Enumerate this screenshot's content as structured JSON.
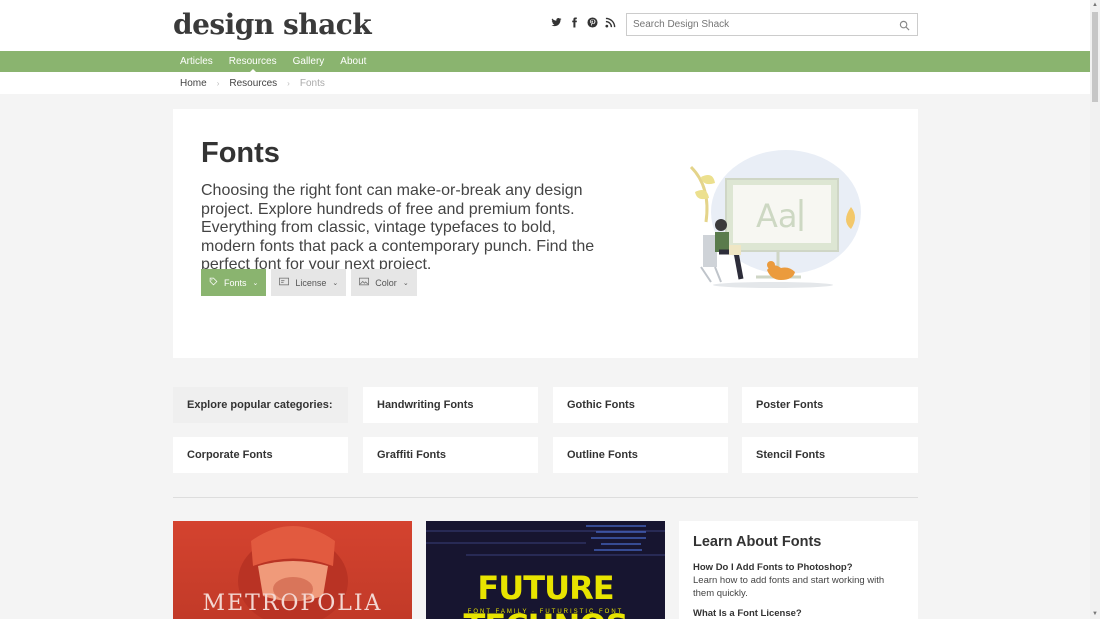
{
  "brand": {
    "logo": "design shack"
  },
  "social": [
    {
      "name": "twitter-icon",
      "glyph": "t"
    },
    {
      "name": "facebook-icon",
      "glyph": "f"
    },
    {
      "name": "pinterest-icon",
      "glyph": "p"
    },
    {
      "name": "rss-icon",
      "glyph": "r"
    }
  ],
  "search": {
    "placeholder": "Search Design Shack"
  },
  "nav": [
    {
      "label": "Articles",
      "active": false
    },
    {
      "label": "Resources",
      "active": true
    },
    {
      "label": "Gallery",
      "active": false
    },
    {
      "label": "About",
      "active": false
    }
  ],
  "breadcrumb": {
    "home": "Home",
    "section": "Resources",
    "current": "Fonts"
  },
  "hero": {
    "title": "Fonts",
    "description": "Choosing the right font can make-or-break any design project. Explore hundreds of free and premium fonts. Everything from classic, vintage typefaces to bold, modern fonts that pack a contemporary punch. Find the perfect font for your next project.",
    "filters": [
      {
        "label": "Fonts",
        "active": true,
        "icon": "tag-icon"
      },
      {
        "label": "License",
        "active": false,
        "icon": "license-icon"
      },
      {
        "label": "Color",
        "active": false,
        "icon": "image-icon"
      }
    ]
  },
  "categories": {
    "label": "Explore popular categories:",
    "items": [
      "Handwriting Fonts",
      "Gothic Fonts",
      "Poster Fonts",
      "Corporate Fonts",
      "Graffiti Fonts",
      "Outline Fonts",
      "Stencil Fonts"
    ]
  },
  "cards": [
    {
      "title": "METROPOLIA"
    },
    {
      "title": "FUTURE TECHNOS",
      "subtitle": "FONT FAMILY · FUTURISTIC FONT"
    }
  ],
  "learn": {
    "title": "Learn About Fonts",
    "q1": "How Do I Add Fonts to Photoshop?",
    "a1": "Learn how to add fonts and start working with them quickly.",
    "q2": "What Is a Font License?"
  },
  "colors": {
    "accent": "#8ab46f"
  }
}
